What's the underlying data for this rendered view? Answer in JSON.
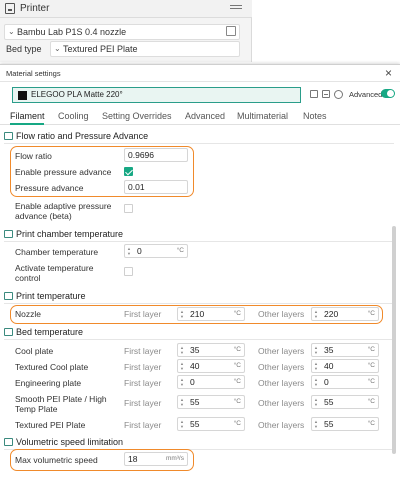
{
  "printer_panel": {
    "title": "Printer",
    "printer_name": "Bambu Lab P1S 0.4 nozzle",
    "bed_type_label": "Bed type",
    "bed_type_value": "Textured PEI Plate"
  },
  "dialog": {
    "title": "Material settings",
    "preset_name": "ELEGOO PLA Matte 220°",
    "advanced_label": "Advanced",
    "advanced_enabled": true,
    "accent_color": "#17a884",
    "highlight_color": "#f08a2b",
    "swatch_color": "#111111"
  },
  "tabs": [
    {
      "label": "Filament",
      "active": true
    },
    {
      "label": "Cooling",
      "active": false
    },
    {
      "label": "Setting Overrides",
      "active": false
    },
    {
      "label": "Advanced",
      "active": false
    },
    {
      "label": "Multimaterial",
      "active": false
    },
    {
      "label": "Notes",
      "active": false
    }
  ],
  "flow": {
    "section_title": "Flow ratio and Pressure Advance",
    "flow_ratio_label": "Flow ratio",
    "flow_ratio_value": "0.9696",
    "enable_pa_label": "Enable pressure advance",
    "enable_pa_checked": true,
    "pa_label": "Pressure advance",
    "pa_value": "0.01",
    "adaptive_pa_label_1": "Enable adaptive pressure",
    "adaptive_pa_label_2": "advance (beta)",
    "adaptive_pa_checked": false
  },
  "chamber": {
    "section_title": "Print chamber temperature",
    "chamber_temp_label": "Chamber temperature",
    "chamber_temp_value": "0",
    "chamber_temp_unit": "°C",
    "activate_label_1": "Activate temperature",
    "activate_label_2": "control",
    "activate_checked": false
  },
  "print_temp": {
    "section_title": "Print temperature",
    "nozzle_label": "Nozzle",
    "first_layer_label": "First layer",
    "other_layers_label": "Other layers",
    "first_layer_value": "210",
    "other_layers_value": "220",
    "unit": "°C"
  },
  "bed_temp": {
    "section_title": "Bed temperature",
    "first_layer_label": "First layer",
    "other_layers_label": "Other layers",
    "unit": "°C",
    "rows": [
      {
        "label": "Cool plate",
        "first": "35",
        "other": "35"
      },
      {
        "label": "Textured Cool plate",
        "first": "40",
        "other": "40"
      },
      {
        "label": "Engineering plate",
        "first": "0",
        "other": "0"
      },
      {
        "label_1": "Smooth PEI Plate / High",
        "label_2": "Temp Plate",
        "first": "55",
        "other": "55"
      },
      {
        "label": "Textured PEI Plate",
        "first": "55",
        "other": "55"
      }
    ]
  },
  "volumetric": {
    "section_title": "Volumetric speed limitation",
    "max_label": "Max volumetric speed",
    "max_value": "18",
    "max_unit": "mm³/s"
  }
}
